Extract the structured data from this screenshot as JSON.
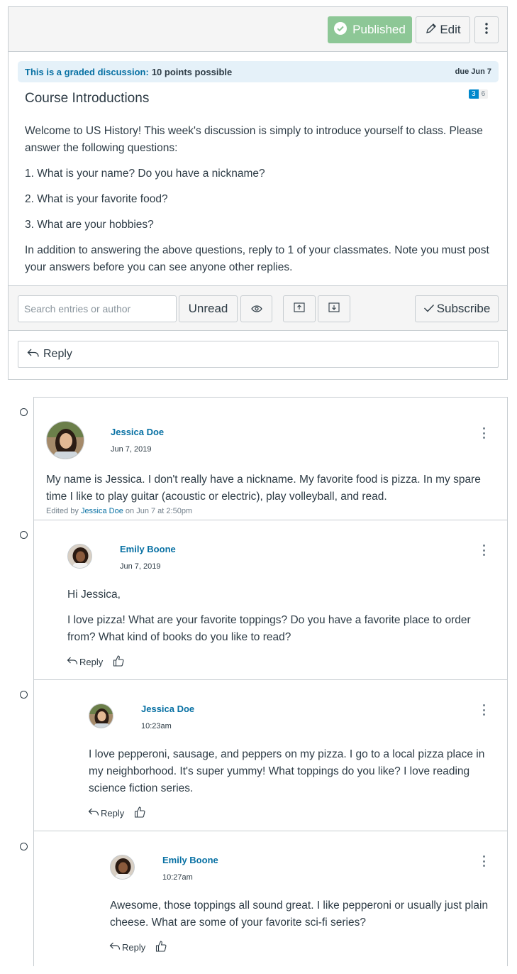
{
  "toolbar": {
    "published_label": "Published",
    "edit_label": "Edit"
  },
  "banner": {
    "lead": "This is a graded discussion:",
    "points": "10 points possible",
    "due": "due Jun 7"
  },
  "topic": {
    "title": "Course Introductions",
    "unread_count": "3",
    "total_count": "6",
    "paragraphs": [
      "Welcome to US History! This week's discussion is simply to introduce yourself to class. Please answer the following questions:",
      "1. What is your name? Do you have a nickname?",
      "2. What is your favorite food?",
      "3. What are your hobbies?",
      "In addition to answering the above questions, reply to 1 of your classmates. Note you must post your answers before you can see anyone other replies."
    ]
  },
  "filters": {
    "search_placeholder": "Search entries or author",
    "unread_label": "Unread",
    "subscribe_label": "Subscribe"
  },
  "reply_label": "Reply",
  "entries": [
    {
      "author": "Jessica Doe",
      "date": "Jun 7, 2019",
      "paragraphs": [
        "My name is Jessica. I don't really have a nickname. My favorite food is pizza. In my spare time I like to play guitar (acoustic or electric), play volleyball, and read."
      ],
      "edited_prefix": "Edited by",
      "edited_by": "Jessica Doe",
      "edited_suffix": "on Jun 7 at 2:50pm"
    },
    {
      "author": "Emily Boone",
      "date": "Jun 7, 2019",
      "paragraphs": [
        "Hi Jessica,",
        "I love pizza! What are your favorite toppings? Do you have a favorite place to order from? What kind of books do you like to read?"
      ],
      "reply_label": "Reply"
    },
    {
      "author": "Jessica Doe",
      "date": "10:23am",
      "paragraphs": [
        "I love pepperoni, sausage, and peppers on my pizza. I go to a local pizza place in my neighborhood. It's super yummy! What toppings do you like? I love reading science fiction series."
      ],
      "reply_label": "Reply"
    },
    {
      "author": "Emily Boone",
      "date": "10:27am",
      "paragraphs": [
        "Awesome, those toppings all sound great. I like pepperoni or usually just plain cheese. What are some of your favorite sci-fi series?"
      ],
      "reply_label": "Reply"
    }
  ],
  "colors": {
    "link": "#0770a3",
    "published_bg": "#8dc796",
    "banner_bg": "#e5f1f9",
    "unread_badge": "#0088cc"
  },
  "icons": [
    "check-circle-icon",
    "pencil-icon",
    "kebab-icon",
    "eye-icon",
    "collapse-icon",
    "expand-icon",
    "checkmark-icon",
    "reply-arrow-icon",
    "thumbs-up-icon",
    "read-status-icon"
  ]
}
